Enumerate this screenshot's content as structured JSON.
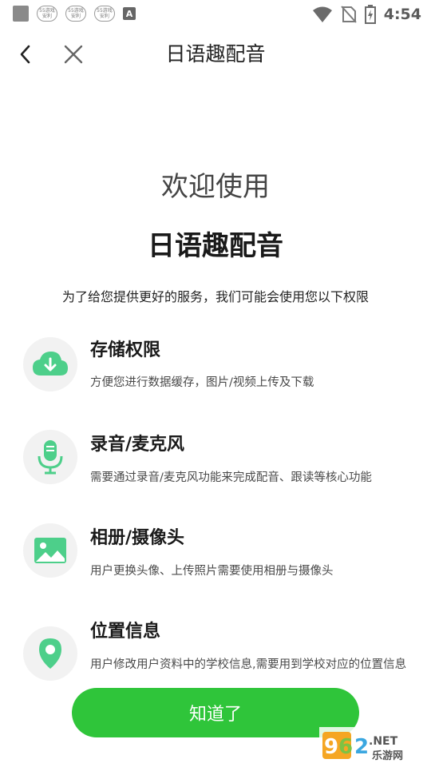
{
  "status_bar": {
    "badge_top": "55游戏",
    "badge_bottom": "安利",
    "time": "4:54",
    "a_glyph": "A",
    "icons": [
      "wifi-icon",
      "no-sim-icon",
      "battery-charging-icon"
    ]
  },
  "header": {
    "title": "日语趣配音",
    "back_icon": "chevron-left-icon",
    "close_icon": "close-icon"
  },
  "welcome": {
    "line1": "欢迎使用",
    "app_name": "日语趣配音",
    "intro": "为了给您提供更好的服务，我们可能会使用您以下权限"
  },
  "permissions": [
    {
      "title": "存储权限",
      "desc": "方便您进行数据缓存，图片/视频上传及下载",
      "icon": "cloud-download-icon"
    },
    {
      "title": "录音/麦克风",
      "desc": "需要通过录音/麦克风功能来完成配音、跟读等核心功能",
      "icon": "microphone-icon"
    },
    {
      "title": "相册/摄像头",
      "desc": "用户更换头像、上传照片需要使用相册与摄像头",
      "icon": "image-icon"
    },
    {
      "title": "位置信息",
      "desc": "用户修改用户资料中的学校信息,需要用到学校对应的位置信息",
      "icon": "location-pin-icon"
    }
  ],
  "button": {
    "label": "知道了"
  },
  "watermark": {
    "top": "962.NET",
    "bottom": "乐游网"
  },
  "colors": {
    "accent": "#2fc53a",
    "icon_green": "#4dcf8a",
    "icon_bg": "#f2f2f2"
  }
}
